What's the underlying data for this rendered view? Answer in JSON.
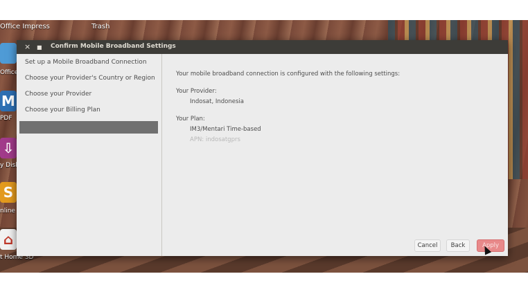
{
  "desktop": {
    "top_labels": [
      "Office Impress",
      "Trash"
    ],
    "dock": [
      {
        "glyph": "",
        "label": "Office",
        "color": "#4f9bd6"
      },
      {
        "glyph": "M",
        "label": "PDF",
        "color": "#2d6fb3"
      },
      {
        "glyph": "⇩",
        "label": "y Disk",
        "color": "#a13a8a"
      },
      {
        "glyph": "S",
        "label": "nline",
        "color": "#e39a1e"
      },
      {
        "glyph": "⌂",
        "label": "t Home 3D",
        "color": "#f2f2f2"
      }
    ]
  },
  "dialog": {
    "title": "Confirm Mobile Broadband Settings",
    "close_glyph": "×",
    "pin_glyph": "■",
    "steps": [
      "Set up a Mobile Broadband Connection",
      "Choose your Provider's Country or Region",
      "Choose your Provider",
      "Choose your Billing Plan",
      ""
    ],
    "active_step_index": 4,
    "content": {
      "intro": "Your mobile broadband connection is configured with the following settings:",
      "provider_heading": "Your Provider:",
      "provider_value": "Indosat, Indonesia",
      "plan_heading": "Your Plan:",
      "plan_value": "IM3/Mentari Time-based",
      "apn_value": "APN: indosatgprs"
    },
    "buttons": {
      "cancel": "Cancel",
      "back": "Back",
      "apply": "Apply"
    },
    "colors": {
      "titlebar": "#3d3c38",
      "active_step": "#707070",
      "apply_button": "#e8898a"
    }
  }
}
